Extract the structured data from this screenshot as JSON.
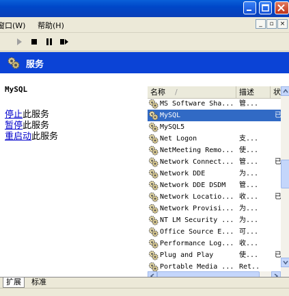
{
  "menu": {
    "window": "窗口(W)",
    "help": "帮助(H)"
  },
  "mdi_controls": [
    "_",
    "▫",
    "×"
  ],
  "toolbar": [
    {
      "name": "play-icon"
    },
    {
      "name": "stop-icon"
    },
    {
      "name": "pause-icon"
    },
    {
      "name": "restart-icon"
    }
  ],
  "header": {
    "title": "服务"
  },
  "detail": {
    "service_name": "MySQL",
    "stop_link": "停止",
    "stop_suffix": "此服务",
    "pause_link": "暂停",
    "pause_suffix": "此服务",
    "restart_link": "重启动",
    "restart_suffix": "此服务"
  },
  "list": {
    "columns": {
      "name": "名称",
      "sort": "/",
      "desc": "描述",
      "status": "状"
    },
    "rows": [
      {
        "name": "MS Software Sha...",
        "desc": "管...",
        "status": ""
      },
      {
        "name": "MySQL",
        "desc": "",
        "status": "已",
        "selected": true
      },
      {
        "name": "MySQL5",
        "desc": "",
        "status": ""
      },
      {
        "name": "Net Logon",
        "desc": "支...",
        "status": ""
      },
      {
        "name": "NetMeeting Remo...",
        "desc": "使...",
        "status": ""
      },
      {
        "name": "Network Connect...",
        "desc": "管...",
        "status": "已"
      },
      {
        "name": "Network DDE",
        "desc": "为...",
        "status": ""
      },
      {
        "name": "Network DDE DSDM",
        "desc": "管...",
        "status": ""
      },
      {
        "name": "Network Locatio...",
        "desc": "收...",
        "status": "已"
      },
      {
        "name": "Network Provisi...",
        "desc": "为...",
        "status": ""
      },
      {
        "name": "NT LM Security ...",
        "desc": "为...",
        "status": ""
      },
      {
        "name": "Office Source E...",
        "desc": "可...",
        "status": ""
      },
      {
        "name": "Performance Log...",
        "desc": "收...",
        "status": ""
      },
      {
        "name": "Plug and Play",
        "desc": "使...",
        "status": "已"
      },
      {
        "name": "Portable Media ...",
        "desc": "Ret...",
        "status": ""
      }
    ]
  },
  "tabs": {
    "extended": "扩展",
    "standard": "标准"
  },
  "colors": {
    "header": "#0b43d6",
    "selection": "#316ac5",
    "link": "#0000cc"
  }
}
